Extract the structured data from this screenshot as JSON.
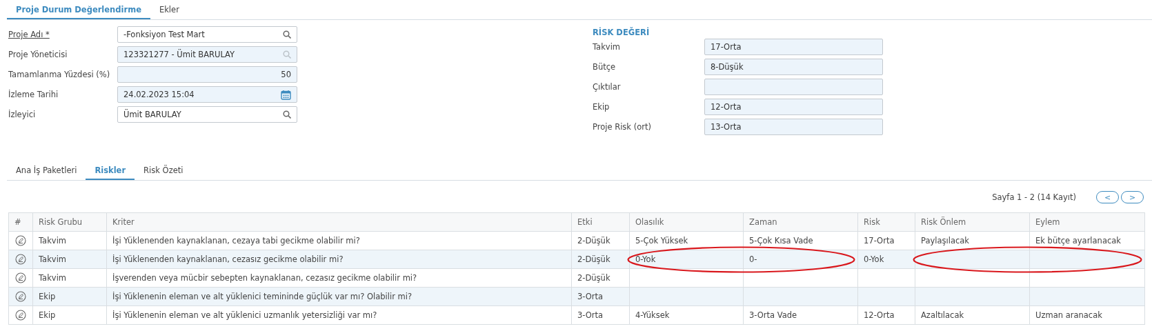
{
  "top_tabs": [
    {
      "label": "Proje Durum Değerlendirme",
      "selected": true
    },
    {
      "label": "Ekler",
      "selected": false
    }
  ],
  "form_fields": [
    {
      "label": "Proje Adı *",
      "kind": "lookup",
      "value": "-Fonksiyon Test Mart",
      "required": true,
      "disabled": false
    },
    {
      "label": "Proje Yöneticisi",
      "kind": "lookup",
      "value": "123321277 - Ümit BARULAY",
      "required": false,
      "disabled": true
    },
    {
      "label": "Tamamlanma Yüzdesi (%)",
      "kind": "number",
      "value": "50",
      "required": false,
      "disabled": true
    },
    {
      "label": "İzleme Tarihi",
      "kind": "date",
      "value": "24.02.2023 15:04",
      "required": false,
      "disabled": true
    },
    {
      "label": "İzleyici",
      "kind": "lookup",
      "value": "Ümit BARULAY",
      "required": false,
      "disabled": false
    }
  ],
  "risk_value": {
    "title": "RİSK DEĞERİ",
    "fields": [
      {
        "label": "Takvim",
        "value": "17-Orta"
      },
      {
        "label": "Bütçe",
        "value": "8-Düşük"
      },
      {
        "label": "Çıktılar"
      },
      {
        "label": "Ekip",
        "value": "12-Orta"
      },
      {
        "label": "Proje Risk (ort)",
        "value": "13-Orta"
      }
    ]
  },
  "sub_tabs": [
    {
      "label": "Ana İş Paketleri",
      "selected": false
    },
    {
      "label": "Riskler",
      "selected": true
    },
    {
      "label": "Risk Özeti",
      "selected": false
    }
  ],
  "pagination": {
    "text": "Sayfa 1 - 2 (14 Kayıt)",
    "prev": "<",
    "next": ">"
  },
  "table": {
    "columns": [
      {
        "label": "#",
        "kind": "edit"
      },
      {
        "label": "Risk Grubu",
        "kind": "text"
      },
      {
        "label": "Kriter",
        "kind": "text"
      },
      {
        "label": "Etki",
        "kind": "text"
      },
      {
        "label": "Olasılık",
        "kind": "text"
      },
      {
        "label": "Zaman",
        "kind": "text"
      },
      {
        "label": "Risk",
        "kind": "text"
      },
      {
        "label": "Risk Önlem",
        "kind": "text"
      },
      {
        "label": "Eylem",
        "kind": "text"
      }
    ],
    "rows": [
      {
        "cells": [
          {
            "circled": false
          },
          {
            "text": "Takvim",
            "circled": false
          },
          {
            "text": "İşi Yüklenenden kaynaklanan, cezaya tabi gecikme olabilir mi?",
            "circled": false
          },
          {
            "text": "2-Düşük",
            "circled": false
          },
          {
            "text": "5-Çok Yüksek",
            "circled": false
          },
          {
            "text": "5-Çok Kısa Vade",
            "circled": false
          },
          {
            "text": "17-Orta",
            "circled": false
          },
          {
            "text": "Paylaşılacak",
            "circled": false
          },
          {
            "text": "Ek bütçe ayarlanacak",
            "circled": false
          }
        ]
      },
      {
        "cells": [
          {
            "circled": false
          },
          {
            "text": "Takvim",
            "circled": false
          },
          {
            "text": "İşi Yüklenenden kaynaklanan, cezasız gecikme olabilir mi?",
            "circled": false
          },
          {
            "text": "2-Düşük",
            "circled": false
          },
          {
            "text": "0-Yok",
            "circled": true
          },
          {
            "text": "0-",
            "circled": true
          },
          {
            "text": "0-Yok",
            "circled": false
          },
          {
            "circled": true
          },
          {
            "circled": true
          }
        ]
      },
      {
        "cells": [
          {
            "circled": false
          },
          {
            "text": "Takvim",
            "circled": false
          },
          {
            "text": "İşverenden veya mücbir sebepten kaynaklanan, cezasız gecikme olabilir mi?",
            "circled": false
          },
          {
            "text": "2-Düşük",
            "circled": false
          },
          {
            "circled": false
          },
          {
            "circled": false
          },
          {
            "circled": false
          },
          {
            "circled": false
          },
          {
            "circled": false
          }
        ]
      },
      {
        "cells": [
          {
            "circled": false
          },
          {
            "text": "Ekip",
            "circled": false
          },
          {
            "text": "İşi Yüklenenin eleman ve alt yüklenici temininde güçlük var mı? Olabilir mi?",
            "circled": false
          },
          {
            "text": "3-Orta",
            "circled": false
          },
          {
            "circled": false
          },
          {
            "circled": false
          },
          {
            "circled": false
          },
          {
            "circled": false
          },
          {
            "circled": false
          }
        ]
      },
      {
        "cells": [
          {
            "circled": false
          },
          {
            "text": "Ekip",
            "circled": false
          },
          {
            "text": "İşi Yüklenenin eleman ve alt yüklenici uzmanlık yetersizliği var mı?",
            "circled": false
          },
          {
            "text": "3-Orta",
            "circled": false
          },
          {
            "text": "4-Yüksek",
            "circled": false
          },
          {
            "text": "3-Orta Vade",
            "circled": false
          },
          {
            "text": "12-Orta",
            "circled": false
          },
          {
            "text": "Azaltılacak",
            "circled": false
          },
          {
            "text": "Uzman aranacak",
            "circled": false
          }
        ]
      }
    ]
  }
}
